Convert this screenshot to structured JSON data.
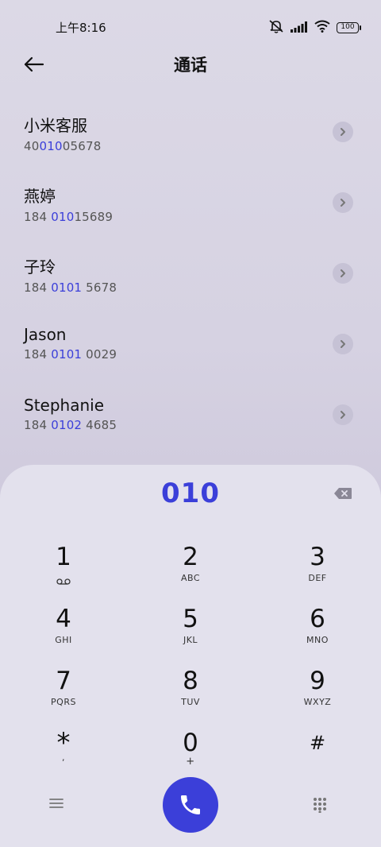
{
  "status": {
    "time": "上午8:16",
    "battery": "100"
  },
  "header": {
    "title": "通话"
  },
  "contacts": [
    {
      "name": "小米客服",
      "number_pre": "40",
      "number_match": "010",
      "number_post": "05678"
    },
    {
      "name": "燕婷",
      "number_pre": "184 ",
      "number_match": "010",
      "number_post": "15689"
    },
    {
      "name": "子玲",
      "number_pre": "184 ",
      "number_match": "0101",
      "number_post": " 5678"
    },
    {
      "name": "Jason",
      "number_pre": "184 ",
      "number_match": "0101",
      "number_post": " 0029"
    },
    {
      "name": "Stephanie",
      "number_pre": "184 ",
      "number_match": "0102",
      "number_post": " 4685"
    }
  ],
  "dialer": {
    "input": "010",
    "keys": [
      {
        "digit": "1",
        "letters": ""
      },
      {
        "digit": "2",
        "letters": "ABC"
      },
      {
        "digit": "3",
        "letters": "DEF"
      },
      {
        "digit": "4",
        "letters": "GHI"
      },
      {
        "digit": "5",
        "letters": "JKL"
      },
      {
        "digit": "6",
        "letters": "MNO"
      },
      {
        "digit": "7",
        "letters": "PQRS"
      },
      {
        "digit": "8",
        "letters": "TUV"
      },
      {
        "digit": "9",
        "letters": "WXYZ"
      },
      {
        "digit": "*",
        "letters": ","
      },
      {
        "digit": "0",
        "letters": "+"
      },
      {
        "digit": "#",
        "letters": ""
      }
    ]
  },
  "colors": {
    "accent": "#3b3fd9",
    "dialer_bg": "#e3e1ed"
  }
}
